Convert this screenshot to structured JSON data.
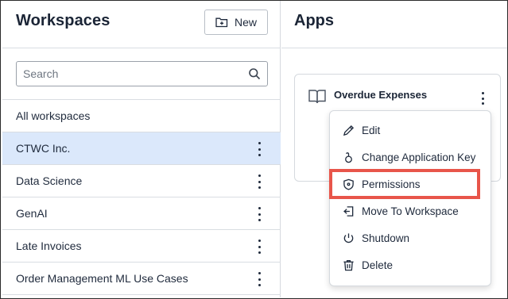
{
  "workspaces": {
    "title": "Workspaces",
    "new_button_label": "New",
    "search_placeholder": "Search",
    "items": [
      {
        "label": "All workspaces",
        "selected": false,
        "has_menu": false
      },
      {
        "label": "CTWC Inc.",
        "selected": true,
        "has_menu": true
      },
      {
        "label": "Data Science",
        "selected": false,
        "has_menu": true
      },
      {
        "label": "GenAI",
        "selected": false,
        "has_menu": true
      },
      {
        "label": "Late Invoices",
        "selected": false,
        "has_menu": true
      },
      {
        "label": "Order Management ML Use Cases",
        "selected": false,
        "has_menu": true
      }
    ]
  },
  "apps": {
    "title": "Apps",
    "card": {
      "name": "Overdue Expenses",
      "icon": "book-icon"
    },
    "menu": {
      "items": [
        {
          "label": "Edit",
          "icon": "pencil-icon",
          "highlighted": false
        },
        {
          "label": "Change Application Key",
          "icon": "key-icon",
          "highlighted": false
        },
        {
          "label": "Permissions",
          "icon": "shield-icon",
          "highlighted": true
        },
        {
          "label": "Move To Workspace",
          "icon": "move-icon",
          "highlighted": false
        },
        {
          "label": "Shutdown",
          "icon": "power-icon",
          "highlighted": false
        },
        {
          "label": "Delete",
          "icon": "trash-icon",
          "highlighted": false
        }
      ]
    }
  },
  "colors": {
    "selected_row": "#dbe8fb",
    "highlight_outline": "#e8554a",
    "text": "#1f2a3c"
  }
}
